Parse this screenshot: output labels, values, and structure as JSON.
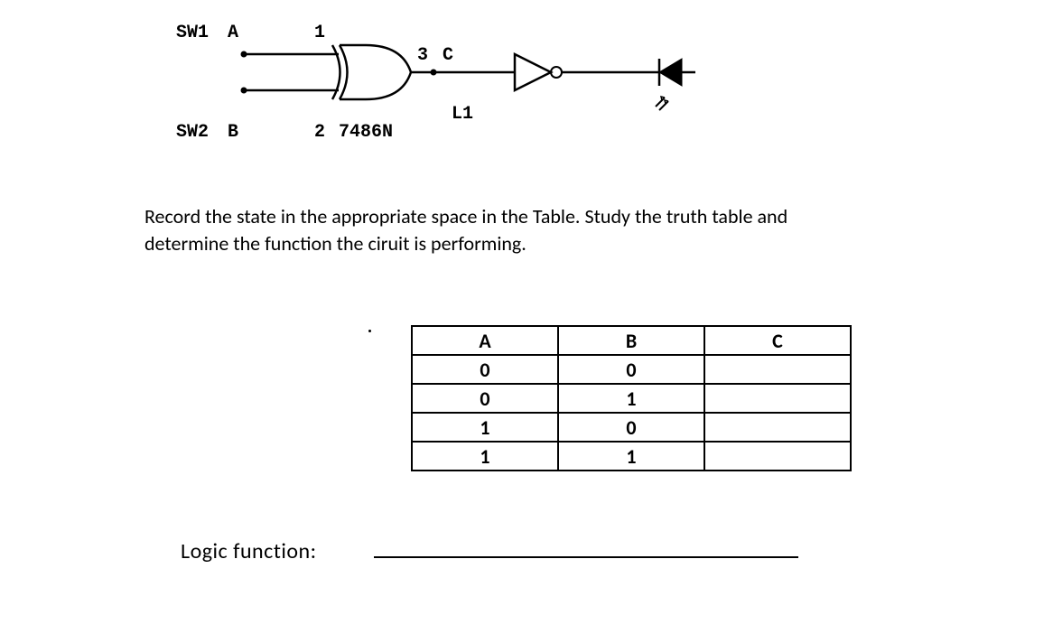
{
  "circuit": {
    "sw1": "SW1",
    "inputA": "A",
    "pin1": "1",
    "sw2": "SW2",
    "inputB": "B",
    "pin2": "2",
    "pin3": "3",
    "outputC": "C",
    "chip": "7486N",
    "L1": "L1",
    "led_symbol": "⯊⯊"
  },
  "instruction": "Record the state in the appropriate space in the Table. Study the truth table and determine the function the ciruit is performing.",
  "table": {
    "headers": {
      "a": "A",
      "b": "B",
      "c": "C"
    },
    "rows": [
      {
        "a": "0",
        "b": "0",
        "c": ""
      },
      {
        "a": "0",
        "b": "1",
        "c": ""
      },
      {
        "a": "1",
        "b": "0",
        "c": ""
      },
      {
        "a": "1",
        "b": "1",
        "c": ""
      }
    ]
  },
  "logic_label": "Logic function:"
}
